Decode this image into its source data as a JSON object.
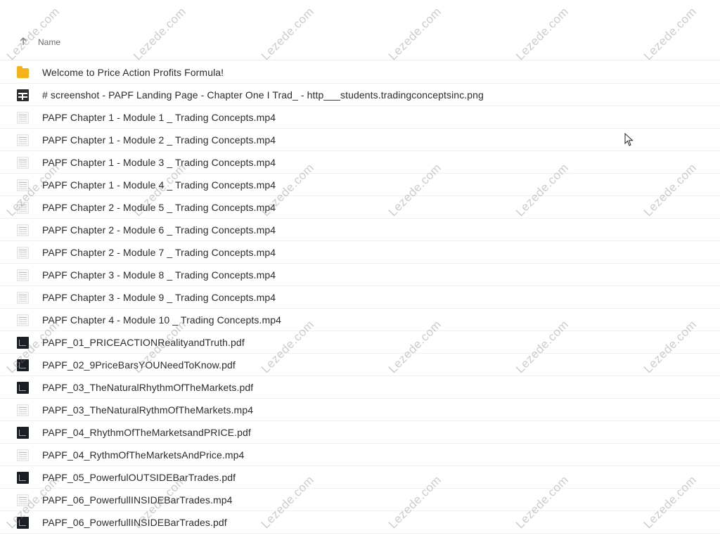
{
  "header": {
    "sort_icon": "arrow-up-icon",
    "name_column": "Name"
  },
  "files": [
    {
      "name": "Welcome to Price Action Profits Formula!",
      "icon": "folder-icon",
      "kind": "folder"
    },
    {
      "name": "# screenshot - PAPF Landing Page - Chapter One I Trad_ - http___students.tradingconceptsinc.png",
      "icon": "image-icon",
      "kind": "image"
    },
    {
      "name": "PAPF Chapter 1 - Module 1 _ Trading Concepts.mp4",
      "icon": "video-icon",
      "kind": "video"
    },
    {
      "name": "PAPF Chapter 1 - Module 2 _ Trading Concepts.mp4",
      "icon": "video-icon",
      "kind": "video"
    },
    {
      "name": "PAPF Chapter 1 - Module 3 _ Trading Concepts.mp4",
      "icon": "video-icon",
      "kind": "video"
    },
    {
      "name": "PAPF Chapter 1 - Module 4 _ Trading Concepts.mp4",
      "icon": "video-icon",
      "kind": "video"
    },
    {
      "name": "PAPF Chapter 2 - Module 5 _ Trading Concepts.mp4",
      "icon": "video-icon",
      "kind": "video"
    },
    {
      "name": "PAPF Chapter 2 - Module 6 _ Trading Concepts.mp4",
      "icon": "video-icon",
      "kind": "video"
    },
    {
      "name": "PAPF Chapter 2 - Module 7 _ Trading Concepts.mp4",
      "icon": "video-icon",
      "kind": "video"
    },
    {
      "name": "PAPF Chapter 3 - Module 8 _ Trading Concepts.mp4",
      "icon": "video-icon",
      "kind": "video"
    },
    {
      "name": "PAPF Chapter 3 - Module 9 _ Trading Concepts.mp4",
      "icon": "video-icon",
      "kind": "video"
    },
    {
      "name": "PAPF Chapter 4 - Module 10 _ Trading Concepts.mp4",
      "icon": "video-icon",
      "kind": "video"
    },
    {
      "name": "PAPF_01_PRICEACTIONRealityandTruth.pdf",
      "icon": "pdf-icon",
      "kind": "pdf"
    },
    {
      "name": "PAPF_02_9PriceBarsYOUNeedToKnow.pdf",
      "icon": "pdf-icon",
      "kind": "pdf"
    },
    {
      "name": "PAPF_03_TheNaturalRhythmOfTheMarkets.pdf",
      "icon": "pdf-icon",
      "kind": "pdf"
    },
    {
      "name": "PAPF_03_TheNaturalRythmOfTheMarkets.mp4",
      "icon": "video-icon",
      "kind": "video"
    },
    {
      "name": "PAPF_04_RhythmOfTheMarketsandPRICE.pdf",
      "icon": "pdf-icon",
      "kind": "pdf"
    },
    {
      "name": "PAPF_04_RythmOfTheMarketsAndPrice.mp4",
      "icon": "video-icon",
      "kind": "video"
    },
    {
      "name": "PAPF_05_PowerfulOUTSIDEBarTrades.pdf",
      "icon": "pdf-icon",
      "kind": "pdf"
    },
    {
      "name": "PAPF_06_PowerfullINSIDEBarTrades.mp4",
      "icon": "video-icon",
      "kind": "video"
    },
    {
      "name": "PAPF_06_PowerfullINSIDEBarTrades.pdf",
      "icon": "pdf-icon",
      "kind": "pdf"
    }
  ],
  "watermark_text": "Lezede.com",
  "colors": {
    "folder": "#f5b21b",
    "text": "#2b2b2b",
    "header_text": "#6d6d6d",
    "divider": "#f0f0f0"
  }
}
